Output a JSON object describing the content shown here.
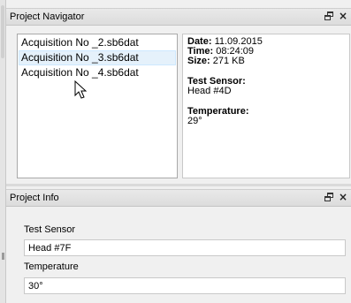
{
  "navigator": {
    "title": "Project Navigator",
    "files": [
      "Acquisition No _2.sb6dat",
      "Acquisition No _3.sb6dat",
      "Acquisition No _4.sb6dat"
    ],
    "hovered_index": 1,
    "details": {
      "date_label": "Date:",
      "date_value": "11.09.2015",
      "time_label": "Time:",
      "time_value": "08:24:09",
      "size_label": "Size:",
      "size_value": "271 KB",
      "sensor_label": "Test Sensor:",
      "sensor_value": "Head #4D",
      "temperature_label": "Temperature:",
      "temperature_value": "29°"
    }
  },
  "project_info": {
    "title": "Project Info",
    "test_sensor_label": "Test Sensor",
    "test_sensor_value": "Head #7F",
    "temperature_label": "Temperature",
    "temperature_value": "30°"
  },
  "controls": {
    "float_icon": "float-window-icon",
    "close_icon": "close-icon",
    "close_glyph": "×"
  }
}
